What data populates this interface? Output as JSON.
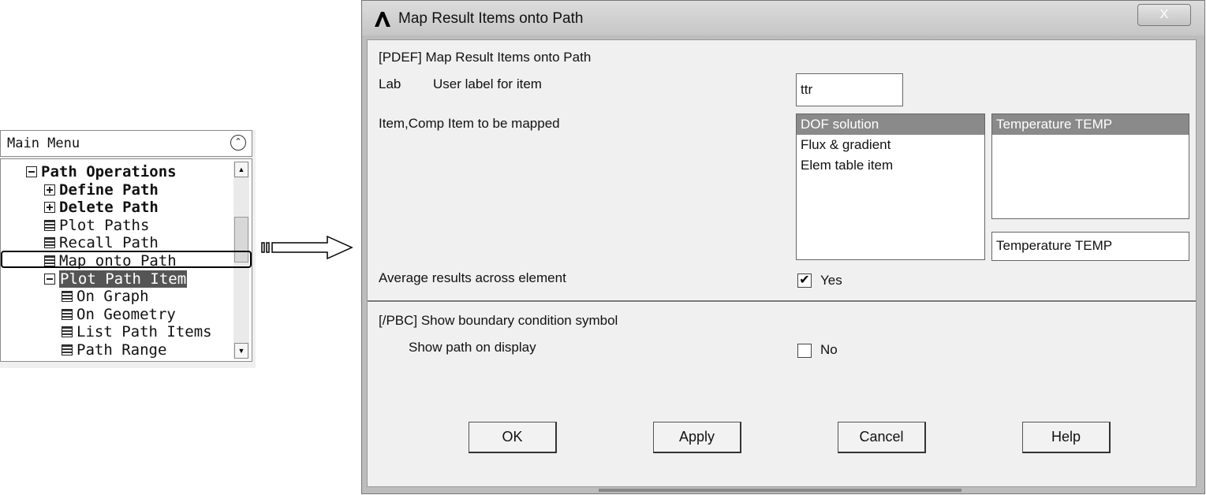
{
  "main_menu": {
    "title": "Main Menu",
    "items": [
      {
        "label": "Path Operations",
        "icon": "minus-box-icon"
      },
      {
        "label": "Define Path",
        "icon": "plus-box-icon"
      },
      {
        "label": "Delete Path",
        "icon": "plus-box-icon"
      },
      {
        "label": "Plot Paths",
        "icon": "menu-leaf-icon"
      },
      {
        "label": "Recall Path",
        "icon": "menu-leaf-icon"
      },
      {
        "label": "Map onto Path",
        "icon": "menu-leaf-icon"
      },
      {
        "label": "Plot Path Item",
        "icon": "minus-box-icon"
      },
      {
        "label": "On Graph",
        "icon": "menu-leaf-icon"
      },
      {
        "label": "On Geometry",
        "icon": "menu-leaf-icon"
      },
      {
        "label": "List Path Items",
        "icon": "menu-leaf-icon"
      },
      {
        "label": "Path Range",
        "icon": "menu-leaf-icon"
      }
    ]
  },
  "dialog": {
    "title": "Map Result Items onto Path",
    "close_label": "X",
    "header": "[PDEF]  Map Result Items onto Path",
    "lab_label": "Lab",
    "lab_desc": "User label for item",
    "lab_value": "ttr",
    "item_label": "Item,Comp  Item to be mapped",
    "item_list": [
      "DOF solution",
      "Flux & gradient",
      "Elem table item"
    ],
    "comp_list": [
      "Temperature TEMP"
    ],
    "comp_value": "Temperature TEMP",
    "avg_label": "Average results across element",
    "avg_checked": true,
    "avg_value": "Yes",
    "pbc_label": "[/PBC]  Show boundary condition symbol",
    "show_path_label": "Show path on display",
    "show_path_checked": false,
    "show_path_value": "No",
    "buttons": {
      "ok": "OK",
      "apply": "Apply",
      "cancel": "Cancel",
      "help": "Help"
    }
  }
}
